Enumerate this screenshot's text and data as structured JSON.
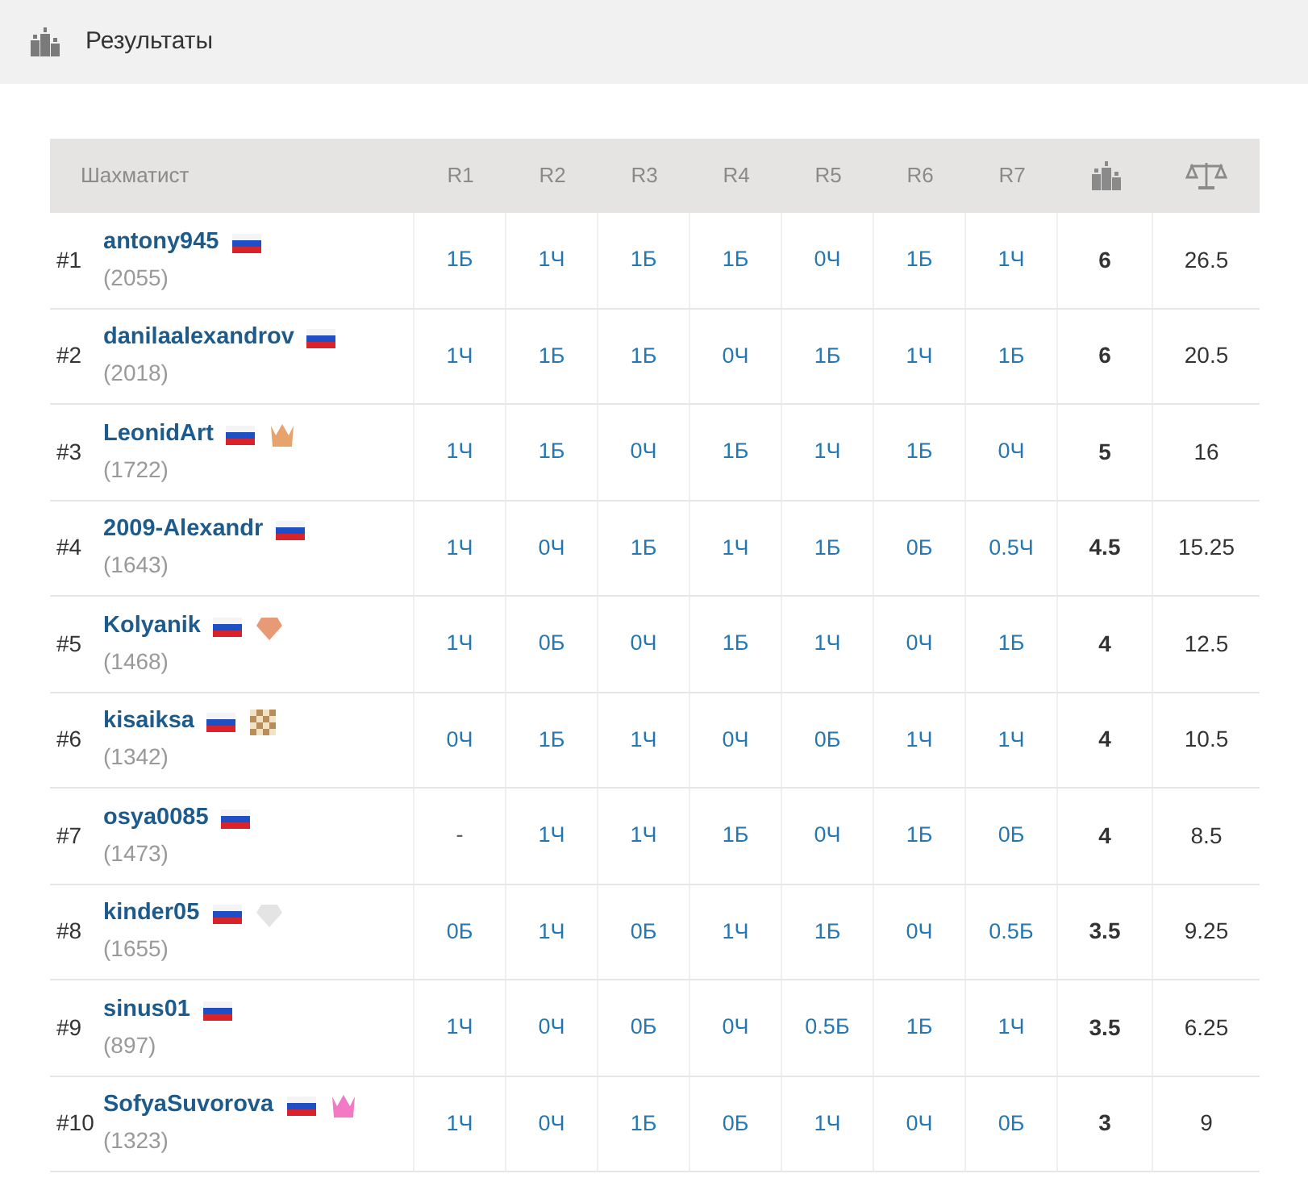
{
  "header": {
    "title": "Результаты"
  },
  "table": {
    "columns": [
      "Шахматист",
      "R1",
      "R2",
      "R3",
      "R4",
      "R5",
      "R6",
      "R7"
    ],
    "rows": [
      {
        "rank": "#1",
        "name": "antony945",
        "rating": "(2055)",
        "results": [
          {
            "text": "1Б",
            "kind": "game"
          },
          {
            "text": "1Ч",
            "kind": "game"
          },
          {
            "text": "1Б",
            "kind": "game"
          },
          {
            "text": "1Б",
            "kind": "game"
          },
          {
            "text": "0Ч",
            "kind": "game"
          },
          {
            "text": "1Б",
            "kind": "game"
          },
          {
            "text": "1Ч",
            "kind": "game"
          }
        ],
        "points": "6",
        "tiebreak": "26.5"
      },
      {
        "rank": "#2",
        "name": "danilaalexandrov",
        "rating": "(2018)",
        "results": [
          {
            "text": "1Ч",
            "kind": "game"
          },
          {
            "text": "1Б",
            "kind": "game"
          },
          {
            "text": "1Б",
            "kind": "game"
          },
          {
            "text": "0Ч",
            "kind": "game"
          },
          {
            "text": "1Б",
            "kind": "game"
          },
          {
            "text": "1Ч",
            "kind": "game"
          },
          {
            "text": "1Б",
            "kind": "game"
          }
        ],
        "points": "6",
        "tiebreak": "20.5"
      },
      {
        "rank": "#3",
        "name": "LeonidArt",
        "rating": "(1722)",
        "badge": {
          "kind": "crown",
          "color": "#e7a36b"
        },
        "results": [
          {
            "text": "1Ч",
            "kind": "game"
          },
          {
            "text": "1Б",
            "kind": "game"
          },
          {
            "text": "0Ч",
            "kind": "game"
          },
          {
            "text": "1Б",
            "kind": "game"
          },
          {
            "text": "1Ч",
            "kind": "game"
          },
          {
            "text": "1Б",
            "kind": "game"
          },
          {
            "text": "0Ч",
            "kind": "game"
          }
        ],
        "points": "5",
        "tiebreak": "16"
      },
      {
        "rank": "#4",
        "name": "2009-Alexandr",
        "rating": "(1643)",
        "results": [
          {
            "text": "1Ч",
            "kind": "game"
          },
          {
            "text": "0Ч",
            "kind": "game"
          },
          {
            "text": "1Б",
            "kind": "game"
          },
          {
            "text": "1Ч",
            "kind": "game"
          },
          {
            "text": "1Б",
            "kind": "game"
          },
          {
            "text": "0Б",
            "kind": "game"
          },
          {
            "text": "0.5Ч",
            "kind": "game"
          }
        ],
        "points": "4.5",
        "tiebreak": "15.25"
      },
      {
        "rank": "#5",
        "name": "Kolyanik",
        "rating": "(1468)",
        "badge": {
          "kind": "gem",
          "color": "#e89a77"
        },
        "results": [
          {
            "text": "1Ч",
            "kind": "game"
          },
          {
            "text": "0Б",
            "kind": "game"
          },
          {
            "text": "0Ч",
            "kind": "game"
          },
          {
            "text": "1Б",
            "kind": "game"
          },
          {
            "text": "1Ч",
            "kind": "game"
          },
          {
            "text": "0Ч",
            "kind": "game"
          },
          {
            "text": "1Б",
            "kind": "game"
          }
        ],
        "points": "4",
        "tiebreak": "12.5"
      },
      {
        "rank": "#6",
        "name": "kisaiksa",
        "rating": "(1342)",
        "badge": {
          "kind": "chessboard",
          "color": "#b98d5a"
        },
        "results": [
          {
            "text": "0Ч",
            "kind": "game"
          },
          {
            "text": "1Б",
            "kind": "game"
          },
          {
            "text": "1Ч",
            "kind": "game"
          },
          {
            "text": "0Ч",
            "kind": "game"
          },
          {
            "text": "0Б",
            "kind": "game"
          },
          {
            "text": "1Ч",
            "kind": "game"
          },
          {
            "text": "1Ч",
            "kind": "game"
          }
        ],
        "points": "4",
        "tiebreak": "10.5"
      },
      {
        "rank": "#7",
        "name": "osya0085",
        "rating": "(1473)",
        "results": [
          {
            "text": "-",
            "kind": "none"
          },
          {
            "text": "1Ч",
            "kind": "game"
          },
          {
            "text": "1Ч",
            "kind": "game"
          },
          {
            "text": "1Б",
            "kind": "game"
          },
          {
            "text": "0Ч",
            "kind": "game"
          },
          {
            "text": "1Б",
            "kind": "game"
          },
          {
            "text": "0Б",
            "kind": "game"
          }
        ],
        "points": "4",
        "tiebreak": "8.5"
      },
      {
        "rank": "#8",
        "name": "kinder05",
        "rating": "(1655)",
        "badge": {
          "kind": "gem",
          "color": "#e4e4e4"
        },
        "results": [
          {
            "text": "0Б",
            "kind": "game"
          },
          {
            "text": "1Ч",
            "kind": "game"
          },
          {
            "text": "0Б",
            "kind": "game"
          },
          {
            "text": "1Ч",
            "kind": "game"
          },
          {
            "text": "1Б",
            "kind": "game"
          },
          {
            "text": "0Ч",
            "kind": "game"
          },
          {
            "text": "0.5Б",
            "kind": "game"
          }
        ],
        "points": "3.5",
        "tiebreak": "9.25"
      },
      {
        "rank": "#9",
        "name": "sinus01",
        "rating": "(897)",
        "results": [
          {
            "text": "1Ч",
            "kind": "game"
          },
          {
            "text": "0Ч",
            "kind": "game"
          },
          {
            "text": "0Б",
            "kind": "game"
          },
          {
            "text": "0Ч",
            "kind": "game"
          },
          {
            "text": "0.5Б",
            "kind": "game"
          },
          {
            "text": "1Б",
            "kind": "game"
          },
          {
            "text": "1Ч",
            "kind": "game"
          }
        ],
        "points": "3.5",
        "tiebreak": "6.25"
      },
      {
        "rank": "#10",
        "name": "SofyaSuvorova",
        "rating": "(1323)",
        "badge": {
          "kind": "crown",
          "color": "#f27ac4"
        },
        "results": [
          {
            "text": "1Ч",
            "kind": "game"
          },
          {
            "text": "0Ч",
            "kind": "game"
          },
          {
            "text": "1Б",
            "kind": "game"
          },
          {
            "text": "0Б",
            "kind": "game"
          },
          {
            "text": "1Ч",
            "kind": "game"
          },
          {
            "text": "0Ч",
            "kind": "game"
          },
          {
            "text": "0Б",
            "kind": "game"
          }
        ],
        "points": "3",
        "tiebreak": "9"
      }
    ]
  }
}
